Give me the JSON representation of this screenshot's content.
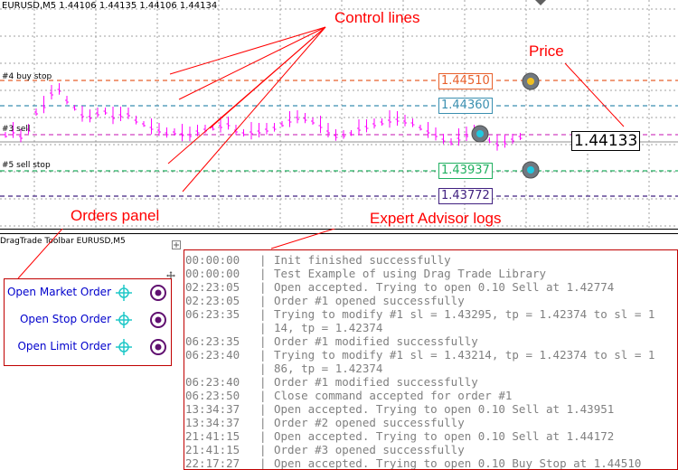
{
  "chart": {
    "header": "EURUSD,M5  1.44106 1.44135 1.44106 1.44134",
    "levels": [
      {
        "label": "#4 buy stop",
        "price": "1.44510",
        "color": "#e8602c"
      },
      {
        "label": "",
        "price": "1.44360",
        "color": "#3a8fb0"
      },
      {
        "label": "#3 sell",
        "price": "",
        "color": "#d040c0"
      },
      {
        "label": "#5 sell stop",
        "price": "1.43937",
        "color": "#20b060"
      },
      {
        "label": "",
        "price": "1.43772",
        "color": "#402080"
      }
    ],
    "current_price": "1.44133"
  },
  "annotations": {
    "control_lines": "Control lines",
    "price": "Price",
    "orders_panel": "Orders panel",
    "expert_advisor_logs": "Expert Advisor logs"
  },
  "subwindow": {
    "title": "DragTrade Toolbar EURUSD,M5"
  },
  "orders_panel": {
    "items": [
      {
        "label": "Open Market Order"
      },
      {
        "label": "Open Stop Order"
      },
      {
        "label": "Open Limit Order"
      }
    ]
  },
  "logs": {
    "separator": "|",
    "rows": [
      {
        "time": "00:00:00",
        "msg": "Init finished successfully"
      },
      {
        "time": "00:00:00",
        "msg": "Test Example of using Drag Trade Library"
      },
      {
        "time": "02:23:05",
        "msg": "Open accepted. Trying to open 0.10 Sell at 1.42774"
      },
      {
        "time": "02:23:05",
        "msg": "Order #1 opened successfully"
      },
      {
        "time": "06:23:35",
        "msg": "Trying to modify #1 sl = 1.43295, tp = 1.42374 to sl = 1"
      },
      {
        "time": "",
        "msg": "14, tp = 1.42374"
      },
      {
        "time": "06:23:35",
        "msg": "Order #1  modified successfully"
      },
      {
        "time": "06:23:40",
        "msg": "Trying to modify #1 sl = 1.43214, tp = 1.42374 to sl = 1"
      },
      {
        "time": "",
        "msg": "86, tp = 1.42374"
      },
      {
        "time": "06:23:40",
        "msg": "Order #1  modified successfully"
      },
      {
        "time": "06:23:50",
        "msg": "Close command accepted for order #1"
      },
      {
        "time": "13:34:37",
        "msg": "Open accepted. Trying to open 0.10 Sell at 1.43951"
      },
      {
        "time": "13:34:37",
        "msg": "Order #2 opened successfully"
      },
      {
        "time": "21:41:15",
        "msg": "Open accepted. Trying to open 0.10 Sell at 1.44172"
      },
      {
        "time": "21:41:15",
        "msg": "Order #3 opened successfully"
      },
      {
        "time": "22:17:27",
        "msg": "Open accepted. Trying to open 0.10 Buy Stop at 1.44510"
      }
    ]
  }
}
